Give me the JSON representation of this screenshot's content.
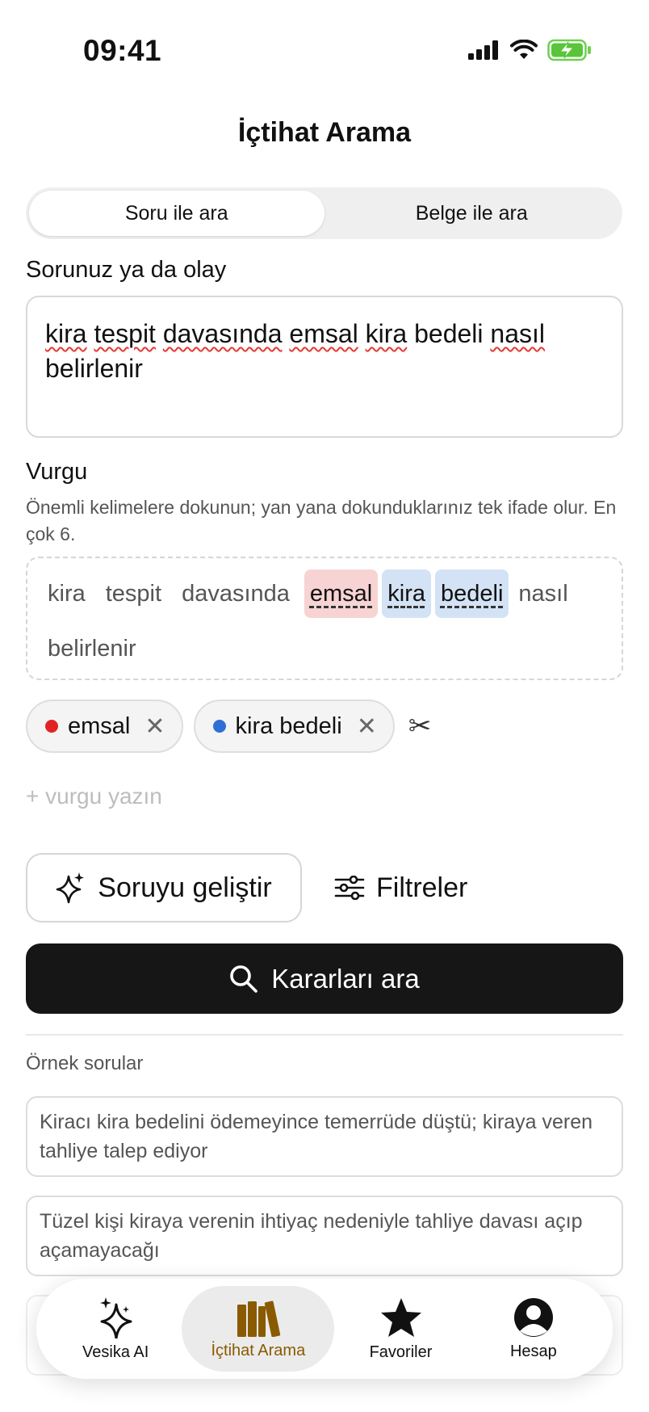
{
  "status": {
    "time": "09:41"
  },
  "title": "İçtihat Arama",
  "segments": [
    "Soru ile ara",
    "Belge ile ara"
  ],
  "question": {
    "label": "Sorunuz ya da olay",
    "words": [
      "kira",
      "tespit",
      "davasında",
      "emsal",
      "kira",
      "bedeli",
      "nasıl",
      "belirlenir"
    ]
  },
  "emphasis": {
    "label": "Vurgu",
    "help": "Önemli kelimelere dokunun; yan yana dokunduklarınız tek ifade olur. En çok 6.",
    "tokens": [
      "kira",
      "tespit",
      "davasında",
      "emsal",
      "kira",
      "bedeli",
      "nasıl",
      "belirlenir"
    ],
    "chips": [
      {
        "label": "emsal",
        "color": "#e02424"
      },
      {
        "label": "kira bedeli",
        "color": "#2f6fd6"
      }
    ],
    "add_placeholder": "+ vurgu yazın"
  },
  "actions": {
    "improve": "Soruyu geliştir",
    "filters": "Filtreler",
    "search": "Kararları ara"
  },
  "examples": {
    "label": "Örnek sorular",
    "items": [
      "Kiracı kira bedelini ödemeyince temerrüde düştü; kiraya veren tahliye talep ediyor",
      "Tüzel kişi kiraya verenin ihtiyaç nedeniyle tahliye davası açıp açamayacağı"
    ]
  },
  "tabs": [
    {
      "label": "Vesika AI",
      "icon": "sparkles-icon"
    },
    {
      "label": "İçtihat Arama",
      "icon": "books-icon",
      "active": true
    },
    {
      "label": "Favoriler",
      "icon": "star-icon"
    },
    {
      "label": "Hesap",
      "icon": "account-icon"
    }
  ],
  "colors": {
    "accent": "#8a5a00",
    "primary_button": "#161616"
  }
}
